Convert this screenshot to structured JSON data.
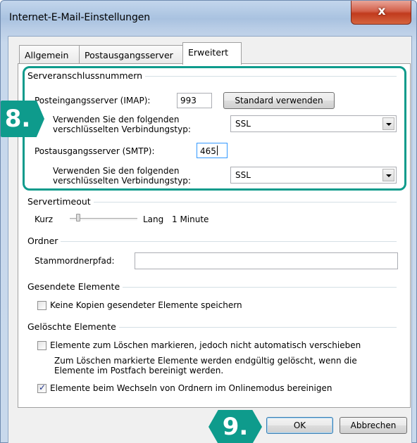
{
  "window": {
    "title": "Internet-E-Mail-Einstellungen",
    "close_glyph": "x"
  },
  "tabs": [
    {
      "label": "Allgemein"
    },
    {
      "label": "Postausgangsserver"
    },
    {
      "label": "Erweitert"
    }
  ],
  "server_ports": {
    "group_label": "Serveranschlussnummern",
    "incoming_label": "Posteingangsserver (IMAP):",
    "incoming_value": "993",
    "default_button": "Standard verwenden",
    "encryption_label_1": "Verwenden Sie den folgenden verschlüsselten Verbindungstyp:",
    "incoming_encryption": "SSL",
    "outgoing_label": "Postausgangsserver (SMTP):",
    "outgoing_value": "465",
    "encryption_label_2": "Verwenden Sie den folgenden verschlüsselten Verbindungstyp:",
    "outgoing_encryption": "SSL"
  },
  "timeout": {
    "group_label": "Servertimeout",
    "short_label": "Kurz",
    "long_label": "Lang",
    "value": "1 Minute",
    "level": 0.1
  },
  "folders": {
    "group_label": "Ordner",
    "root_label": "Stammordnerpfad:",
    "root_value": ""
  },
  "sent": {
    "group_label": "Gesendete Elemente",
    "no_copies_label": "Keine Kopien gesendeter Elemente speichern",
    "no_copies_checked": false
  },
  "deleted": {
    "group_label": "Gelöschte Elemente",
    "mark_label": "Elemente zum Löschen markieren, jedoch nicht automatisch verschieben",
    "mark_checked": false,
    "mark_note": "Zum Löschen markierte Elemente werden endgültig gelöscht, wenn die Elemente im Postfach bereinigt werden.",
    "purge_label": "Elemente beim Wechseln von Ordnern im Onlinemodus bereinigen",
    "purge_checked": true
  },
  "buttons": {
    "ok": "OK",
    "cancel": "Abbrechen"
  },
  "overlay": {
    "step_8": "8.",
    "step_9": "9.",
    "accent_color": "#0e9b8c"
  }
}
